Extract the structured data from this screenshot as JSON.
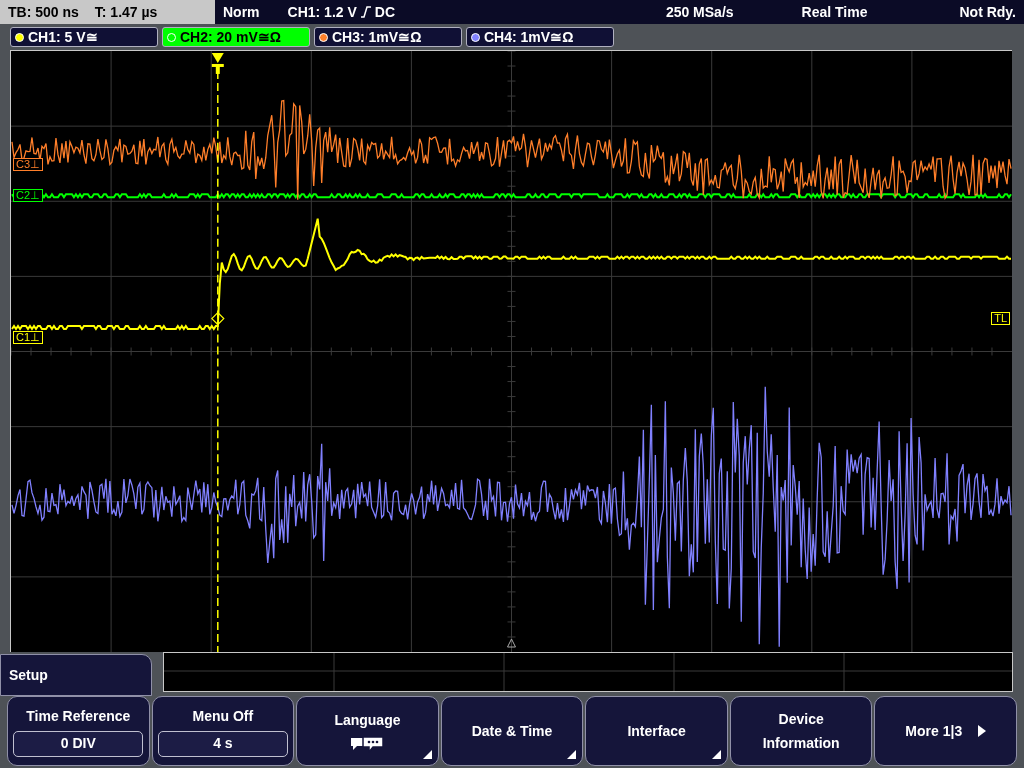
{
  "status_bar": {
    "timebase": "TB: 500 ns",
    "trigger_time": "T: 1.47 µs",
    "mode": "Norm",
    "trigger_source": "CH1: 1.2 V",
    "trigger_coupling": "DC",
    "sample_rate": "250 MSa/s",
    "acquisition": "Real Time",
    "state": "Not Rdy."
  },
  "channels": [
    {
      "label": "CH1: 5 V≅",
      "color": "#ffff00",
      "selected": false
    },
    {
      "label": "CH2: 20 mV≅Ω",
      "color": "#00ff00",
      "selected": true
    },
    {
      "label": "CH3: 1mV≅Ω",
      "color": "#ff7f2a",
      "selected": false
    },
    {
      "label": "CH4: 1mV≅Ω",
      "color": "#8080ff",
      "selected": false
    }
  ],
  "markers": [
    {
      "text": "C3⊥",
      "color": "#ff7f2a"
    },
    {
      "text": "C2⊥",
      "color": "#00ff00"
    },
    {
      "text": "C1⊥",
      "color": "#ffff00"
    },
    {
      "text": "TL",
      "color": "#ffff00"
    }
  ],
  "menu": {
    "title": "Setup",
    "softkeys": [
      {
        "kind": "value",
        "label": "Time Reference",
        "value": "0 DIV",
        "has_submenu": false
      },
      {
        "kind": "value",
        "label": "Menu Off",
        "value": "4 s",
        "has_submenu": false
      },
      {
        "kind": "language",
        "label": "Language",
        "has_submenu": true
      },
      {
        "kind": "plain",
        "label": "Date & Time",
        "has_submenu": true
      },
      {
        "kind": "plain",
        "label": "Interface",
        "has_submenu": true
      },
      {
        "kind": "plain",
        "label": "Device Information",
        "has_submenu": false
      },
      {
        "kind": "page",
        "label": "More 1|3",
        "has_submenu": false
      }
    ]
  }
}
